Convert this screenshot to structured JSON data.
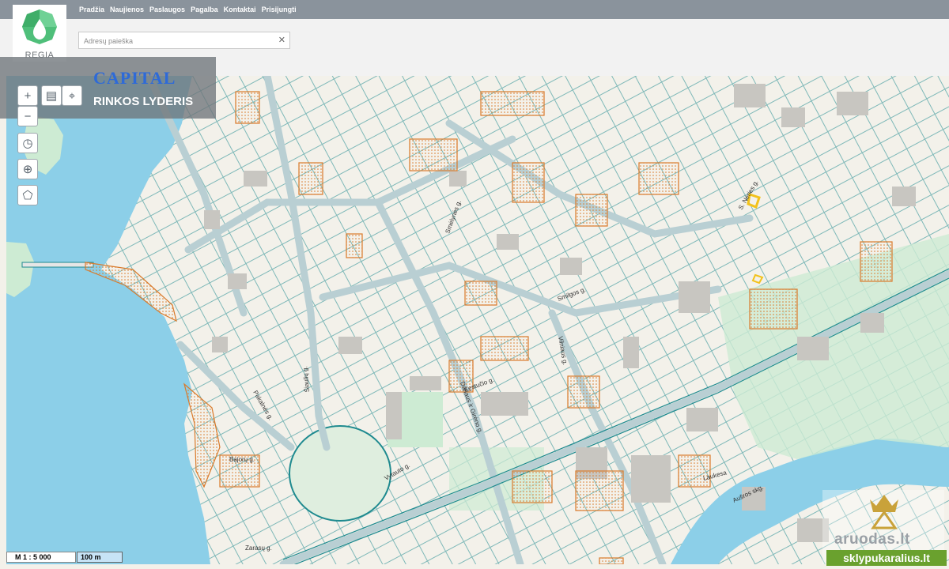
{
  "nav": {
    "items": [
      {
        "label": "Pradžia"
      },
      {
        "label": "Naujienos"
      },
      {
        "label": "Paslaugos"
      },
      {
        "label": "Pagalba"
      },
      {
        "label": "Kontaktai"
      },
      {
        "label": "Prisijungti"
      }
    ]
  },
  "logo": {
    "label": "REGIA"
  },
  "search": {
    "placeholder": "Adresų paieška",
    "clear_icon": "close-icon"
  },
  "ad": {
    "brand": "CAPITAL",
    "tagline": "RINKOS LYDERIS"
  },
  "toolbar": {
    "icons": [
      "zoom-in-icon",
      "measure-icon",
      "marker-icon",
      "layers-icon",
      "info-icon",
      "zoom-out-icon",
      "history-icon",
      "locate-icon",
      "select-area-icon"
    ]
  },
  "map": {
    "colors": {
      "water": "#8ccfe8",
      "land": "#f3f1ea",
      "park": "#cdebd3",
      "building": "#c8c6c1",
      "road": "#b9cfd3",
      "parcel": "#1e8a8f",
      "highlight": "#d97a2b"
    },
    "streets": [
      "Šiaulių g.",
      "S. Nėries g.",
      "Smilgos g.",
      "Vilniaus g.",
      "Dariaus ir Girėno g.",
      "Vytauto g.",
      "Laukesa",
      "Aušros skg.",
      "Bajorų g.",
      "Zarasų g.",
      "Pakalnės g.",
      "Smėlynės g.",
      "Kęstučio g."
    ]
  },
  "scale": {
    "ratio": "M 1 : 5 000",
    "bar": "100 m"
  },
  "watermark": {
    "brand": "aruodas.lt",
    "site": "sklypukaralius.lt",
    "logo_icon": "crown-pin-icon"
  }
}
